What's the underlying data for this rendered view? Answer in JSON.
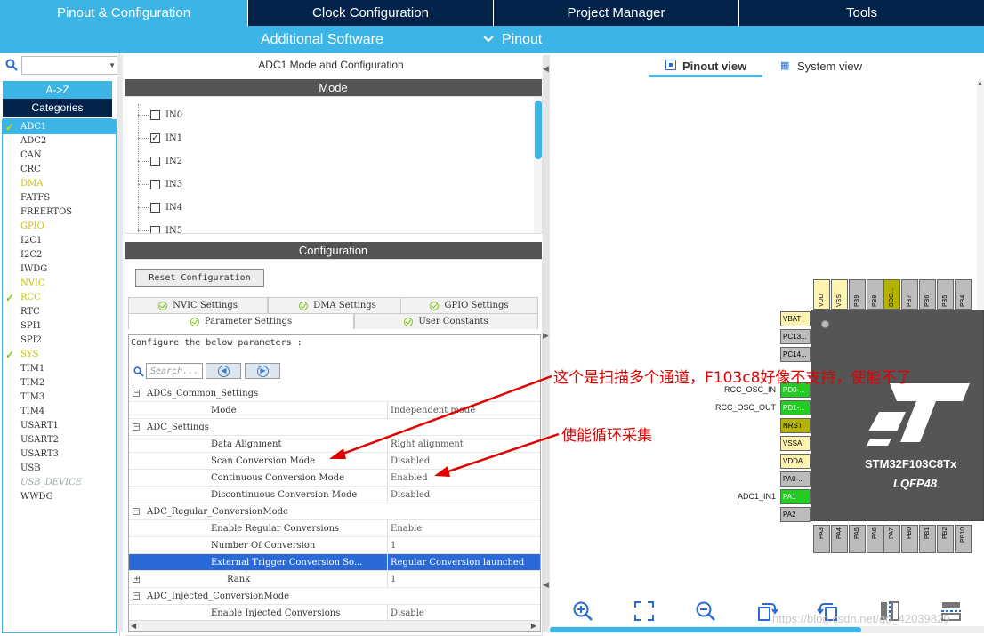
{
  "top_tabs": [
    "Pinout & Configuration",
    "Clock Configuration",
    "Project Manager",
    "Tools"
  ],
  "subbar": {
    "additional_software": "Additional Software",
    "pinout": "Pinout"
  },
  "left": {
    "az": "A->Z",
    "categories": "Categories",
    "items": [
      {
        "label": "ADC1",
        "state": "selected"
      },
      {
        "label": "ADC2",
        "state": "normal"
      },
      {
        "label": "CAN",
        "state": "normal"
      },
      {
        "label": "CRC",
        "state": "normal"
      },
      {
        "label": "DMA",
        "state": "yellow"
      },
      {
        "label": "FATFS",
        "state": "normal"
      },
      {
        "label": "FREERTOS",
        "state": "normal"
      },
      {
        "label": "GPIO",
        "state": "yellow"
      },
      {
        "label": "I2C1",
        "state": "normal"
      },
      {
        "label": "I2C2",
        "state": "normal"
      },
      {
        "label": "IWDG",
        "state": "normal"
      },
      {
        "label": "NVIC",
        "state": "yellow"
      },
      {
        "label": "RCC",
        "state": "checked"
      },
      {
        "label": "RTC",
        "state": "normal"
      },
      {
        "label": "SPI1",
        "state": "normal"
      },
      {
        "label": "SPI2",
        "state": "normal"
      },
      {
        "label": "SYS",
        "state": "checked"
      },
      {
        "label": "TIM1",
        "state": "normal"
      },
      {
        "label": "TIM2",
        "state": "normal"
      },
      {
        "label": "TIM3",
        "state": "normal"
      },
      {
        "label": "TIM4",
        "state": "normal"
      },
      {
        "label": "USART1",
        "state": "normal"
      },
      {
        "label": "USART2",
        "state": "normal"
      },
      {
        "label": "USART3",
        "state": "normal"
      },
      {
        "label": "USB",
        "state": "normal"
      },
      {
        "label": "USB_DEVICE",
        "state": "disabled"
      },
      {
        "label": "WWDG",
        "state": "normal"
      }
    ]
  },
  "middle": {
    "title": "ADC1 Mode and Configuration",
    "mode_header": "Mode",
    "channels": [
      {
        "label": "IN0",
        "checked": false
      },
      {
        "label": "IN1",
        "checked": true
      },
      {
        "label": "IN2",
        "checked": false
      },
      {
        "label": "IN3",
        "checked": false
      },
      {
        "label": "IN4",
        "checked": false
      },
      {
        "label": "IN5",
        "checked": false
      }
    ],
    "config_header": "Configuration",
    "reset_button": "Reset Configuration",
    "tabs_row1": [
      "NVIC Settings",
      "DMA Settings",
      "GPIO Settings"
    ],
    "tabs_row2": [
      "Parameter Settings",
      "User Constants"
    ],
    "configure_text": "Configure the below parameters :",
    "search_placeholder": "Search...",
    "params": [
      {
        "type": "group",
        "label": "ADCs_Common_Settings"
      },
      {
        "type": "param",
        "name": "Mode",
        "value": "Independent mode"
      },
      {
        "type": "group",
        "label": "ADC_Settings"
      },
      {
        "type": "param",
        "name": "Data Alignment",
        "value": "Right alignment"
      },
      {
        "type": "param",
        "name": "Scan Conversion Mode",
        "value": "Disabled"
      },
      {
        "type": "param",
        "name": "Continuous Conversion Mode",
        "value": "Enabled"
      },
      {
        "type": "param",
        "name": "Discontinuous Conversion Mode",
        "value": "Disabled"
      },
      {
        "type": "group",
        "label": "ADC_Regular_ConversionMode"
      },
      {
        "type": "param",
        "name": "Enable Regular Conversions",
        "value": "Enable"
      },
      {
        "type": "param",
        "name": "Number Of Conversion",
        "value": "1"
      },
      {
        "type": "param",
        "name": "External Trigger Conversion So...",
        "value": "Regular Conversion launched",
        "selected": true
      },
      {
        "type": "rank",
        "name": "Rank",
        "value": "1"
      },
      {
        "type": "group",
        "label": "ADC_Injected_ConversionMode"
      },
      {
        "type": "param",
        "name": "Enable Injected Conversions",
        "value": "Disable"
      }
    ]
  },
  "right": {
    "pinout_view": "Pinout view",
    "system_view": "System view",
    "chip_name": "STM32F103C8Tx",
    "chip_package": "LQFP48",
    "top_pins": [
      {
        "label": "VDD",
        "color": "#fff3b0"
      },
      {
        "label": "VSS",
        "color": "#fff3b0"
      },
      {
        "label": "PB9",
        "color": "#bcbcbc"
      },
      {
        "label": "PB8",
        "color": "#bcbcbc"
      },
      {
        "label": "BOO...",
        "color": "#b3b300"
      },
      {
        "label": "PB7",
        "color": "#bcbcbc"
      },
      {
        "label": "PB6",
        "color": "#bcbcbc"
      },
      {
        "label": "PB5",
        "color": "#bcbcbc"
      },
      {
        "label": "PB4",
        "color": "#bcbcbc"
      }
    ],
    "left_pins": [
      {
        "label": "VBAT",
        "color": "#fff3b0",
        "ext": ""
      },
      {
        "label": "PC13...",
        "color": "#bcbcbc",
        "ext": ""
      },
      {
        "label": "PC14...",
        "color": "#bcbcbc",
        "ext": ""
      },
      {
        "label": "PD0-...",
        "color": "#22cc22",
        "ext": "RCC_OSC_IN"
      },
      {
        "label": "PD1-...",
        "color": "#22cc22",
        "ext": "RCC_OSC_OUT"
      },
      {
        "label": "NRST",
        "color": "#b3b300",
        "ext": ""
      },
      {
        "label": "VSSA",
        "color": "#fff3b0",
        "ext": ""
      },
      {
        "label": "VDDA",
        "color": "#fff3b0",
        "ext": ""
      },
      {
        "label": "PA0-...",
        "color": "#bcbcbc",
        "ext": ""
      },
      {
        "label": "PA1",
        "color": "#22cc22",
        "ext": "ADC1_IN1"
      },
      {
        "label": "PA2",
        "color": "#bcbcbc",
        "ext": ""
      }
    ],
    "bottom_pins": [
      "PA3",
      "PA4",
      "PA5",
      "PA6",
      "PA7",
      "PB0",
      "PB1",
      "PB2",
      "PB10"
    ],
    "watermark": "https://blog.csdn.net/qq_42039829"
  },
  "annotations": {
    "scan": "这个是扫描多个通道，F103c8好像不支持，使能不了",
    "continuous": "使能循环采集"
  },
  "colors": {
    "accent": "#3cb4e6",
    "navy": "#03234b",
    "selected_row": "#2a6ad8",
    "annotation": "#e00000"
  }
}
